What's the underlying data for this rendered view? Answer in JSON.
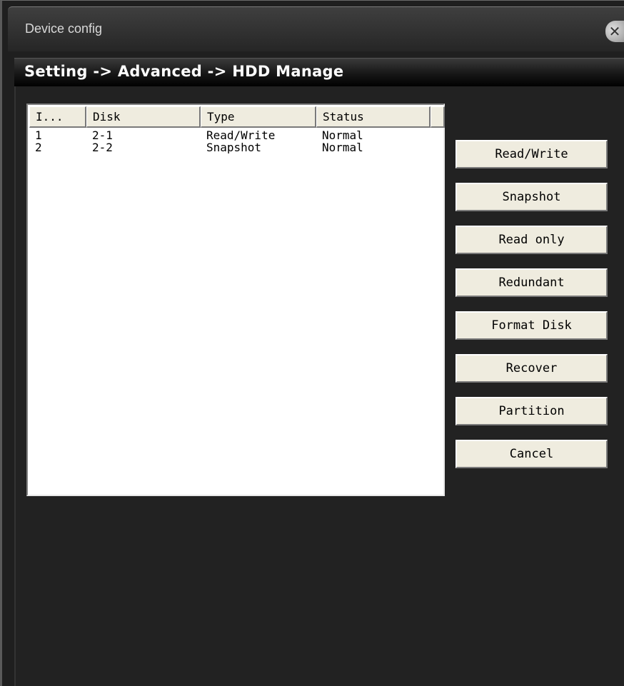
{
  "window": {
    "title": "Device config"
  },
  "breadcrumb": "Setting -> Advanced -> HDD Manage",
  "table": {
    "columns": [
      "I...",
      "Disk",
      "Type",
      "Status",
      ""
    ],
    "rows": [
      [
        "1",
        "2-1",
        "Read/Write",
        "Normal"
      ],
      [
        "2",
        "2-2",
        "Snapshot",
        "Normal"
      ]
    ]
  },
  "buttons": {
    "read_write": "Read/Write",
    "snapshot": "Snapshot",
    "read_only": "Read only",
    "redundant": "Redundant",
    "format_disk": "Format Disk",
    "recover": "Recover",
    "partition": "Partition",
    "cancel": "Cancel"
  },
  "icons": {
    "close": "close-icon"
  },
  "colors": {
    "background": "#1f1f1f",
    "button_face": "#efecdf",
    "list_background": "#ffffff"
  }
}
